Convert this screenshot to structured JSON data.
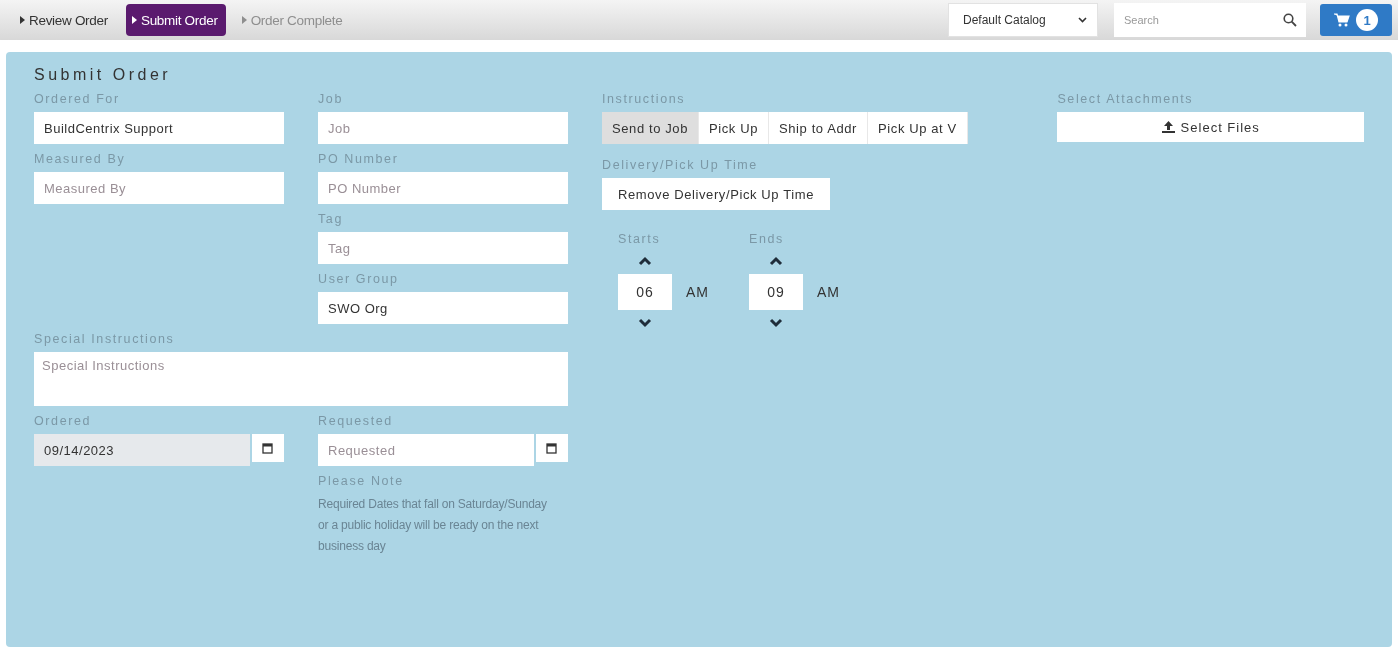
{
  "steps": [
    {
      "label": "Review Order",
      "selected": false,
      "disabled": false
    },
    {
      "label": "Submit Order",
      "selected": true,
      "disabled": false
    },
    {
      "label": "Order Complete",
      "selected": false,
      "disabled": true
    }
  ],
  "catalog": {
    "value": "Default Catalog"
  },
  "search": {
    "placeholder": "Search"
  },
  "cart": {
    "count": "1"
  },
  "title": "Submit Order",
  "fields": [
    {
      "label": "Ordered For",
      "value": "BuildCentrix Support"
    },
    {
      "label": "Job",
      "placeholder": "Job"
    },
    {
      "label": "Measured By",
      "placeholder": "Measured By"
    },
    {
      "label": "PO Number",
      "placeholder": "PO Number"
    },
    {
      "label": "Tag",
      "placeholder": "Tag"
    },
    {
      "label": "User Group",
      "value": "SWO Org"
    }
  ],
  "special_instructions": {
    "label": "Special Instructions",
    "placeholder": "Special Instructions"
  },
  "dates": [
    {
      "label": "Ordered",
      "value": "09/14/2023",
      "disabled": true
    },
    {
      "label": "Requested",
      "placeholder": "Requested",
      "disabled": false
    }
  ],
  "note": {
    "title": "Please Note",
    "text": "Required Dates that fall on Saturday/Sunday or a public holiday will be ready on the next business day"
  },
  "instructions": {
    "label": "Instructions",
    "options": [
      {
        "label": "Send to Job",
        "selected": true
      },
      {
        "label": "Pick Up",
        "selected": false
      },
      {
        "label": "Ship to Addr",
        "selected": false
      },
      {
        "label": "Pick Up at V",
        "selected": false
      }
    ]
  },
  "delivery": {
    "label": "Delivery/Pick Up Time",
    "button": "Remove Delivery/Pick Up Time",
    "times": [
      {
        "label": "Starts",
        "hour": "06",
        "period": "AM"
      },
      {
        "label": "Ends",
        "hour": "09",
        "period": "AM"
      }
    ]
  },
  "attachments": {
    "label": "Select Attachments",
    "button": "Select Files"
  }
}
